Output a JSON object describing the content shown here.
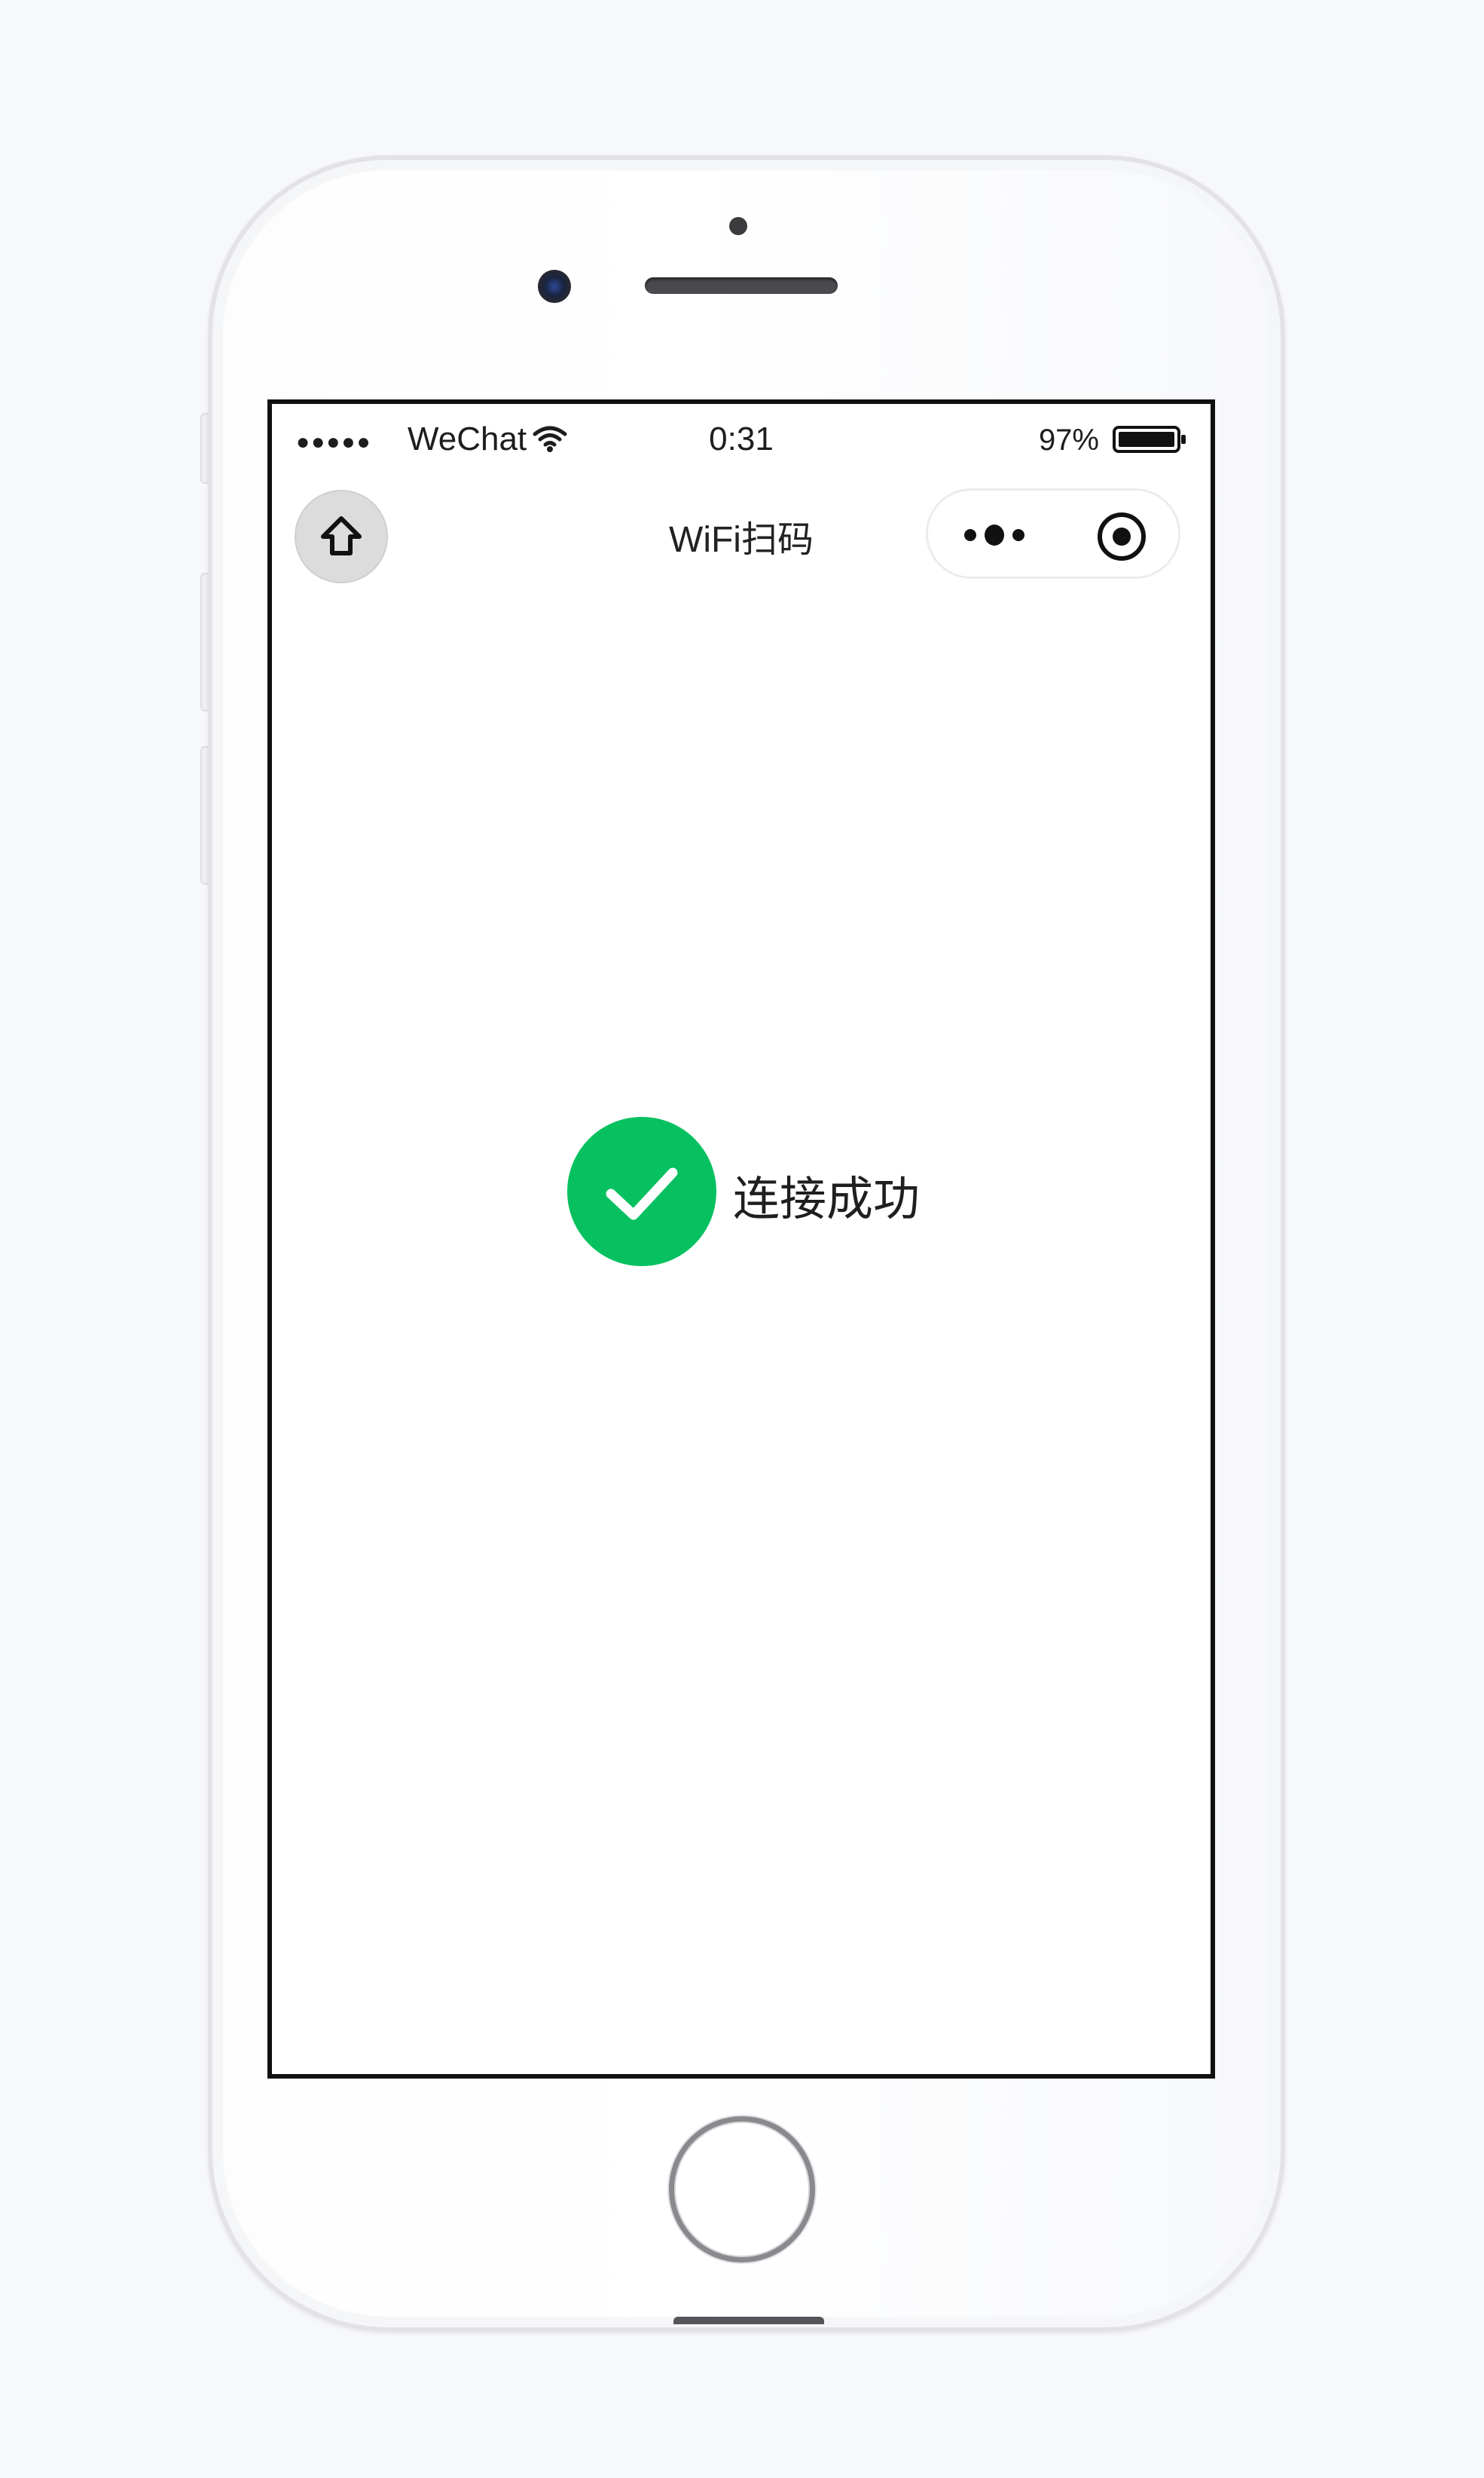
{
  "status_bar": {
    "signal": "●●●●●",
    "carrier": "WeChat",
    "time": "0:31",
    "battery": "97%"
  },
  "nav": {
    "title": "WiFi扫码",
    "home_icon": "home-icon",
    "more_icon": "more-dots-icon",
    "close_icon": "target-close-icon"
  },
  "result": {
    "icon": "checkmark-icon",
    "message": "连接成功"
  },
  "colors": {
    "success": "#07c160",
    "text": "#1f1f1f",
    "screen_border": "#111111"
  }
}
